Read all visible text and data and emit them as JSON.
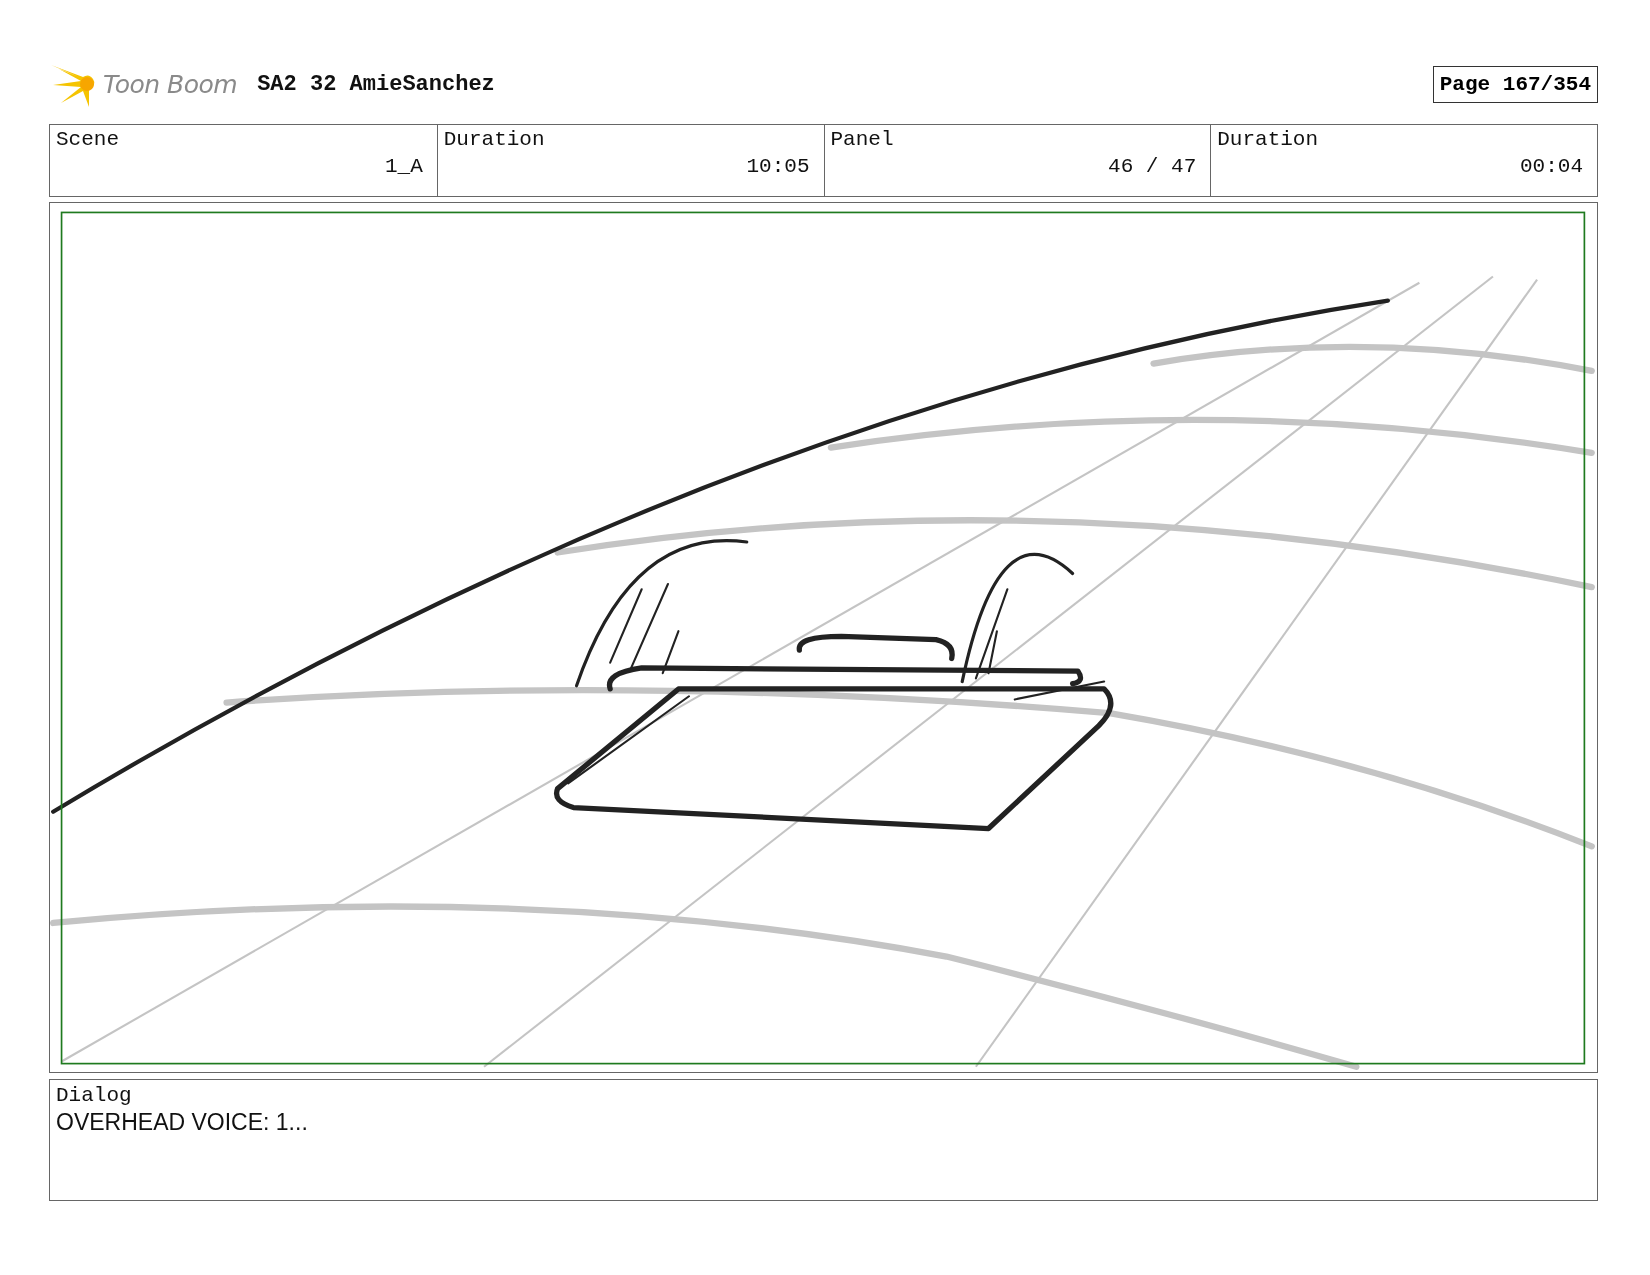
{
  "header": {
    "logo_text": "Toon Boom",
    "project": "SA2 32 AmieSanchez",
    "page": "Page 167/354"
  },
  "info": [
    {
      "label": "Scene",
      "value": "1_A"
    },
    {
      "label": "Duration",
      "value": "10:05"
    },
    {
      "label": "Panel",
      "value": "46 / 47"
    },
    {
      "label": "Duration",
      "value": "00:04"
    }
  ],
  "dialog": {
    "label": "Dialog",
    "text": "OVERHEAD VOICE: 1..."
  }
}
